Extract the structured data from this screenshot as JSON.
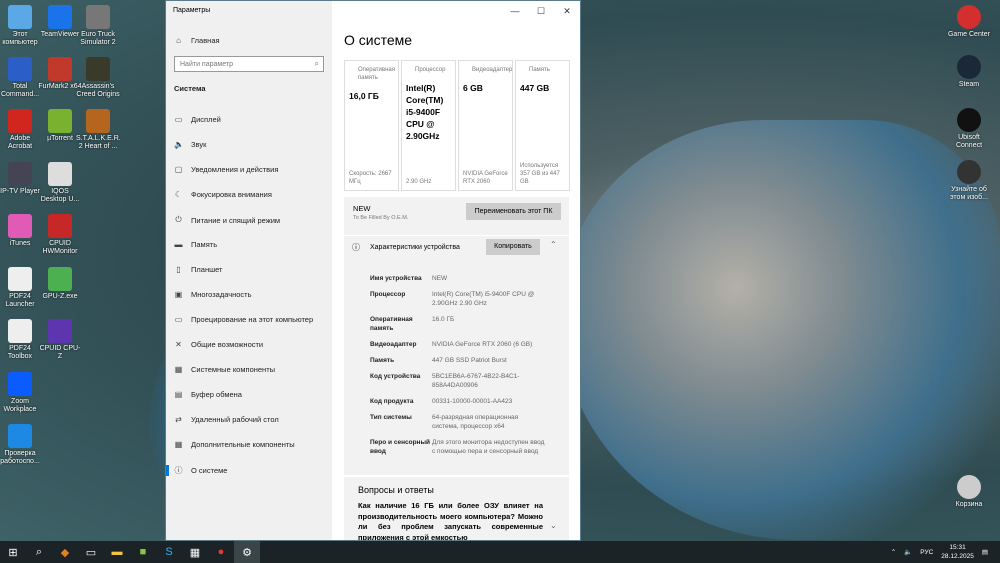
{
  "desktop_left": [
    {
      "label": "Этот компьютер",
      "color": "#5aa9e6"
    },
    {
      "label": "TeamViewer",
      "color": "#1a73e8"
    },
    {
      "label": "Euro Truck Simulator 2",
      "color": "#777"
    },
    {
      "label": "Total Command...",
      "color": "#2b5fc7"
    },
    {
      "label": "FurMark2 x64",
      "color": "#c0392b"
    },
    {
      "label": "Assassin's Creed Origins",
      "color": "#3a3a2a"
    },
    {
      "label": "Adobe Acrobat",
      "color": "#d0261e"
    },
    {
      "label": "µTorrent",
      "color": "#78b22f"
    },
    {
      "label": "S.T.A.L.K.E.R. 2 Heart of ...",
      "color": "#b5651d"
    },
    {
      "label": "IP-TV Player",
      "color": "#445"
    },
    {
      "label": "IQOS Desktop U...",
      "color": "#ddd"
    },
    {
      "label": "iTunes",
      "color": "#e05bb5"
    },
    {
      "label": "CPUID HWMonitor",
      "color": "#c62828"
    },
    {
      "label": "PDF24 Launcher",
      "color": "#eee"
    },
    {
      "label": "GPU-Z.exe",
      "color": "#4caf50"
    },
    {
      "label": "PDF24 Toolbox",
      "color": "#eee"
    },
    {
      "label": "CPUID CPU-Z",
      "color": "#5e35b1"
    },
    {
      "label": "Zoom Workplace",
      "color": "#0b5cff"
    },
    {
      "label": "Проверка работоспо...",
      "color": "#1e88e5"
    }
  ],
  "desktop_right": [
    {
      "label": "Game Center",
      "color": "#d32f2f"
    },
    {
      "label": "Steam",
      "color": "#1b2838"
    },
    {
      "label": "Ubisoft Connect",
      "color": "#111"
    },
    {
      "label": "Узнайте об этом изоб...",
      "color": "#333"
    },
    {
      "label": "Корзина",
      "color": "#ccc"
    }
  ],
  "window": {
    "title": "Параметры",
    "minimize": "—",
    "maximize": "☐",
    "close": "✕"
  },
  "sidebar": {
    "home": "Главная",
    "search_placeholder": "Найти параметр",
    "section": "Система",
    "items": [
      "Дисплей",
      "Звук",
      "Уведомления и действия",
      "Фокусировка внимания",
      "Питание и спящий режим",
      "Память",
      "Планшет",
      "Многозадачность",
      "Проецирование на этот компьютер",
      "Общие возможности",
      "Системные компоненты",
      "Буфер обмена",
      "Удаленный рабочий стол",
      "Дополнительные компоненты",
      "О системе"
    ]
  },
  "main": {
    "title": "О системе",
    "cards": [
      {
        "label": "Оперативная память",
        "value": "16,0 ГБ",
        "sub": "Скорость: 2667 МГц"
      },
      {
        "label": "Процессор",
        "value": "Intel(R) Core(TM) i5-9400F CPU @ 2.90GHz",
        "sub": "2.90 GHz"
      },
      {
        "label": "Видеоадаптер",
        "value": "6 GB",
        "sub": "NVIDIA GeForce RTX 2060"
      },
      {
        "label": "Память",
        "value": "447 GB",
        "sub": "Используется 357 GB из 447 GB"
      }
    ],
    "pc_name": "NEW",
    "pc_desc": "To Be Filled By O.E.M.",
    "rename": "Переименовать этот ПК",
    "specs_title": "Характеристики устройства",
    "copy": "Копировать",
    "specs": [
      {
        "k": "Имя устройства",
        "v": "NEW"
      },
      {
        "k": "Процессор",
        "v": "Intel(R) Core(TM) i5-9400F CPU @ 2.90GHz 2.90 GHz"
      },
      {
        "k": "Оперативная память",
        "v": "16.0 ГБ"
      },
      {
        "k": "Видеоадаптер",
        "v": "NVIDIA GeForce RTX 2060 (6 GB)"
      },
      {
        "k": "Память",
        "v": "447 GB SSD Patriot Burst"
      },
      {
        "k": "Код устройства",
        "v": "5BC1EB6A-6767-4B22-B4C1-858A4DA00906"
      },
      {
        "k": "Код продукта",
        "v": "00331-10000-00001-AA423"
      },
      {
        "k": "Тип системы",
        "v": "64-разрядная операционная система, процессор x64"
      },
      {
        "k": "Перо и сенсорный ввод",
        "v": "Для этого монитора недоступен ввод с помощью пера и сенсорный ввод"
      }
    ],
    "faq_title": "Вопросы и ответы",
    "faq_q": "Как наличие 16 ГБ или более ОЗУ влияет на производительность моего компьютера? Можно ли без проблем запускать современные приложения с этой емкостью"
  },
  "taskbar": {
    "lang": "РУС",
    "time": "15:31",
    "date": "28.12.2025"
  }
}
